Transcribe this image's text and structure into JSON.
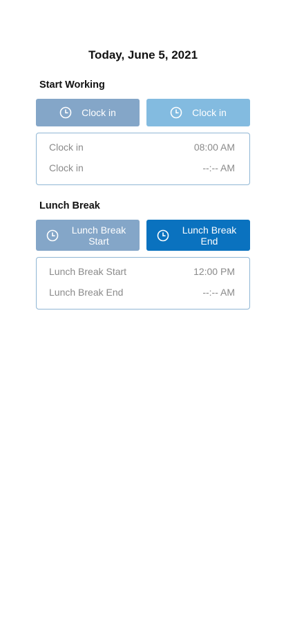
{
  "date_title": "Today, June 5, 2021",
  "start_working": {
    "title": "Start Working",
    "buttons": [
      {
        "label": "Clock in",
        "icon": "clock-icon",
        "color": "#84a6c8"
      },
      {
        "label": "Clock in",
        "icon": "clock-icon",
        "color": "#83bbe0"
      }
    ],
    "entries": [
      {
        "label": "Clock in",
        "time": "08:00 AM"
      },
      {
        "label": "Clock in",
        "time": "--:-- AM"
      }
    ]
  },
  "lunch_break": {
    "title": "Lunch Break",
    "buttons": [
      {
        "label": "Lunch Break Start",
        "icon": "clock-icon",
        "color": "#84a6c8"
      },
      {
        "label": "Lunch Break End",
        "icon": "clock-icon",
        "color": "#0a72bf"
      }
    ],
    "entries": [
      {
        "label": "Lunch Break Start",
        "time": "12:00 PM"
      },
      {
        "label": "Lunch Break End",
        "time": "--:-- AM"
      }
    ]
  }
}
